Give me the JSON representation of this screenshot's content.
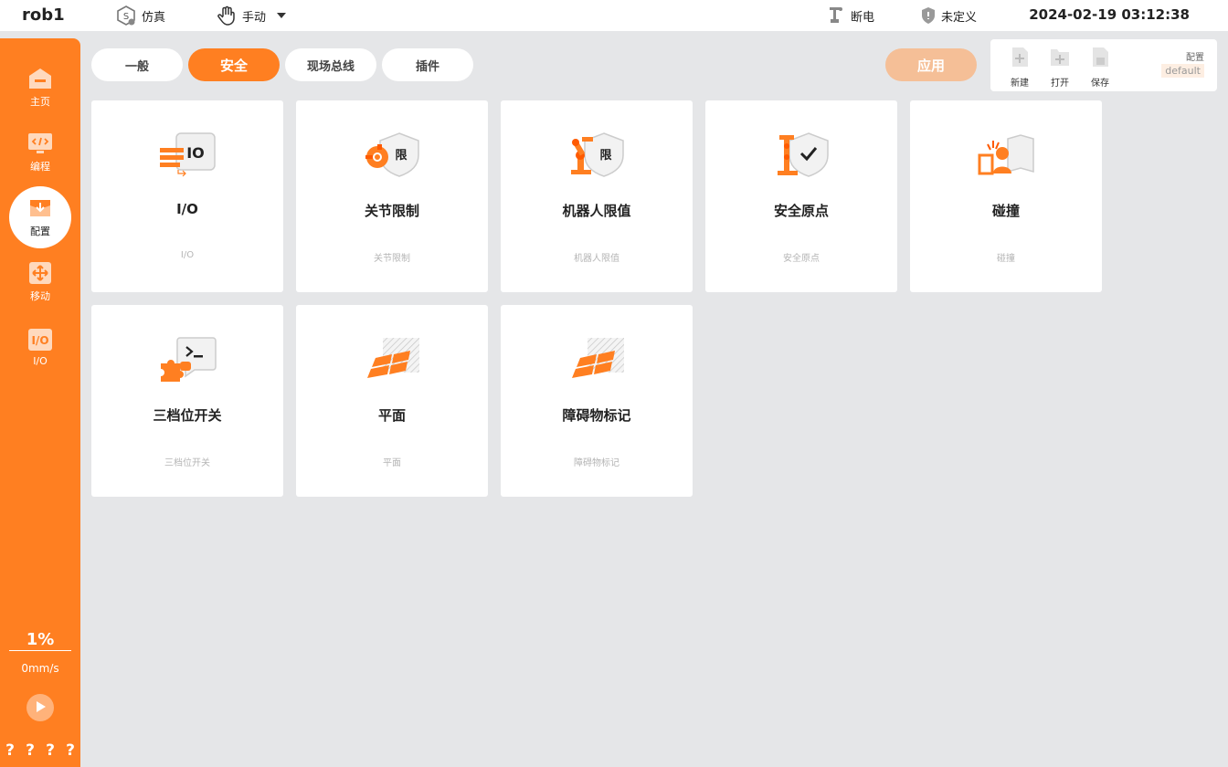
{
  "header": {
    "robot_name": "rob1",
    "mode_label": "仿真",
    "control_label": "手动",
    "power_label": "断电",
    "safety_label": "未定义",
    "datetime": "2024-02-19 03:12:38"
  },
  "sidebar": {
    "items": [
      {
        "label": "主页",
        "icon": "home-icon"
      },
      {
        "label": "编程",
        "icon": "code-icon"
      },
      {
        "label": "配置",
        "icon": "config-icon"
      },
      {
        "label": "移动",
        "icon": "move-icon"
      },
      {
        "label": "I/O",
        "icon": "io-icon"
      }
    ],
    "speed_percent": "1%",
    "speed_value": "0mm/s",
    "status_marks": [
      "?",
      "?",
      "?",
      "?"
    ]
  },
  "tabs": [
    "一般",
    "安全",
    "现场总线",
    "插件"
  ],
  "active_tab": "安全",
  "apply_label": "应用",
  "config_panel": {
    "new_label": "新建",
    "open_label": "打开",
    "save_label": "保存",
    "config_label": "配置",
    "config_value": "default"
  },
  "cards": [
    {
      "title": "I/O",
      "subtitle": "I/O",
      "icon": "io-card-icon"
    },
    {
      "title": "关节限制",
      "subtitle": "关节限制",
      "icon": "joint-limit-icon",
      "badge": "限"
    },
    {
      "title": "机器人限值",
      "subtitle": "机器人限值",
      "icon": "robot-limit-icon",
      "badge": "限"
    },
    {
      "title": "安全原点",
      "subtitle": "安全原点",
      "icon": "safe-home-icon"
    },
    {
      "title": "碰撞",
      "subtitle": "碰撞",
      "icon": "collision-icon"
    },
    {
      "title": "三档位开关",
      "subtitle": "三档位开关",
      "icon": "three-position-switch-icon"
    },
    {
      "title": "平面",
      "subtitle": "平面",
      "icon": "plane-icon"
    },
    {
      "title": "障碍物标记",
      "subtitle": "障碍物标记",
      "icon": "obstacle-marker-icon"
    }
  ],
  "colors": {
    "accent": "#ff7f21",
    "apply_disabled": "#f5bf97",
    "background": "#e5e6e8"
  }
}
